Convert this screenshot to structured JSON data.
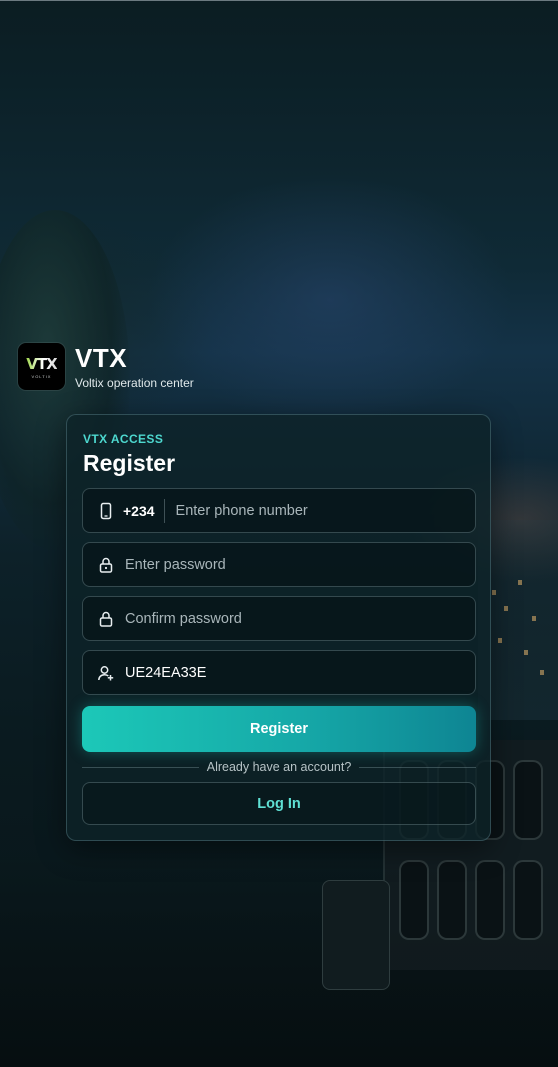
{
  "brand": {
    "logo_text": "VTX",
    "logo_subtext": "VOLTIX",
    "name": "VTX",
    "tagline": "Voltix operation center"
  },
  "form": {
    "eyebrow": "VTX ACCESS",
    "title": "Register",
    "phone": {
      "country_code": "+234",
      "placeholder": "Enter phone number",
      "icon": "phone-icon"
    },
    "password": {
      "placeholder": "Enter password",
      "icon": "lock-icon"
    },
    "confirm_password": {
      "placeholder": "Confirm password",
      "icon": "lock-icon"
    },
    "invite_code": {
      "value": "UE24EA33E",
      "icon": "user-add-icon"
    },
    "register_label": "Register",
    "account_prompt": "Already have an account?",
    "login_label": "Log In"
  },
  "colors": {
    "accent": "#4dd8cf",
    "button_gradient_start": "#1cc8b8",
    "button_gradient_end": "#0e8593",
    "login_text": "#5fe0d4"
  }
}
